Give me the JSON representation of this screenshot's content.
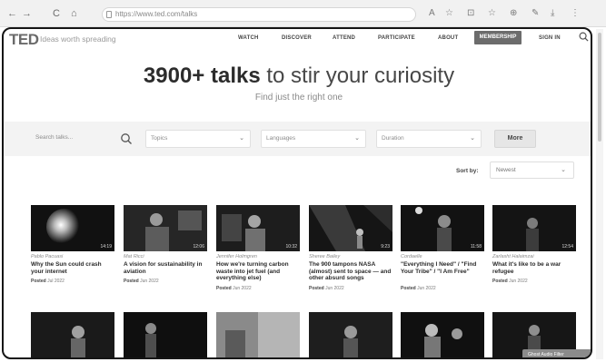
{
  "browser": {
    "back": "←",
    "forward": "→",
    "reload": "C",
    "home": "⌂",
    "url": "https://www.ted.com/talks",
    "icons": [
      "A",
      "☆",
      "⊡",
      "☆",
      "⊕",
      "✎",
      "⤓",
      "⋮"
    ]
  },
  "header": {
    "logo": "TED",
    "tagline": "Ideas worth spreading",
    "nav": [
      "WATCH",
      "DISCOVER",
      "ATTEND",
      "PARTICIPATE",
      "ABOUT"
    ],
    "membership": "MEMBERSHIP",
    "signin": "SIGN IN"
  },
  "hero": {
    "title_bold": "3900+ talks",
    "title_rest": " to stir your curiosity",
    "subtitle": "Find just the right one"
  },
  "filters": {
    "search_placeholder": "Search talks...",
    "topics": "Topics",
    "languages": "Languages",
    "duration": "Duration",
    "more": "More"
  },
  "sort": {
    "label": "Sort by:",
    "value": "Newest"
  },
  "talks": [
    {
      "speaker": "Pablo Pacuasi",
      "title": "Why the Sun could crash your internet",
      "posted_label": "Posted",
      "posted_date": "Jul 2022",
      "duration": "14:19"
    },
    {
      "speaker": "Mat Ricci",
      "title": "A vision for sustainability in aviation",
      "posted_label": "Posted",
      "posted_date": "Jun 2022",
      "duration": "12:06"
    },
    {
      "speaker": "Jennifer Holmgren",
      "title": "How we're turning carbon waste into jet fuel (and everything else)",
      "posted_label": "Posted",
      "posted_date": "Jun 2022",
      "duration": "10:32"
    },
    {
      "speaker": "Sheree Bailey",
      "title": "The 900 tampons NASA (almost) sent to space — and other absurd songs",
      "posted_label": "Posted",
      "posted_date": "Jun 2022",
      "duration": "9:23"
    },
    {
      "speaker": "Cordaelle",
      "title": "\"Everything I Need\" / \"Find Your Tribe\" / \"I Am Free\"",
      "posted_label": "Posted",
      "posted_date": "Jun 2022",
      "duration": "11:58"
    },
    {
      "speaker": "Zarlasht Halaimzai",
      "title": "What it's like to be a war refugee",
      "posted_label": "Posted",
      "posted_date": "Jun 2022",
      "duration": "12:54"
    }
  ],
  "ghost_button": "Ghost Audio Filter"
}
